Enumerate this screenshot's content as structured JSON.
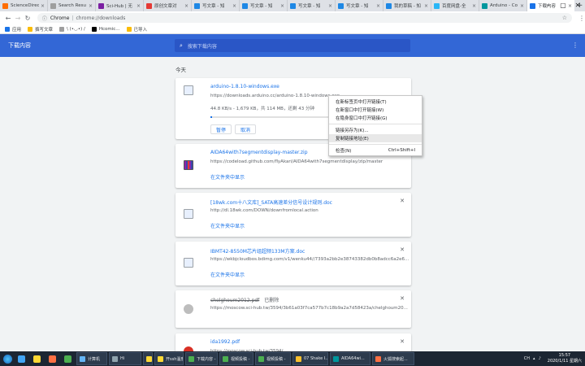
{
  "tabs": [
    {
      "label": "ScienceDirec",
      "color": "#ff6d00"
    },
    {
      "label": "Search Resu",
      "color": "#9e9e9e"
    },
    {
      "label": "Sci-Hub | 无",
      "color": "#7b1fa2"
    },
    {
      "label": "原创文章对",
      "color": "#e53935"
    },
    {
      "label": "写文章 - 知",
      "color": "#1e88e5"
    },
    {
      "label": "写文章 - 知",
      "color": "#1e88e5"
    },
    {
      "label": "写文章 - 知",
      "color": "#1e88e5"
    },
    {
      "label": "写文章 - 知",
      "color": "#1e88e5"
    },
    {
      "label": "我的草稿 - 知",
      "color": "#1e88e5"
    },
    {
      "label": "百度网盘-全",
      "color": "#29b6f6"
    },
    {
      "label": "Arduino - Co",
      "color": "#00979d"
    },
    {
      "label": "下载内容",
      "color": "#1a73e8",
      "active": true
    }
  ],
  "toolbar": {
    "scheme": "Chrome",
    "url": "chrome://downloads"
  },
  "bookmarks": [
    {
      "label": "应用",
      "color": "#1a73e8"
    },
    {
      "label": "撰写文章",
      "color": "#fbbc04"
    },
    {
      "label": "\\ (•◡•) /",
      "color": "#9e9e9e"
    },
    {
      "label": "Hcomic...",
      "color": "#000000"
    },
    {
      "label": "已导入",
      "color": "#fbbc04"
    }
  ],
  "downloads_page": {
    "title": "下载内容",
    "search_placeholder": "搜索下载内容",
    "date_label": "今天"
  },
  "downloads": [
    {
      "name": "arduino-1.8.10-windows.exe",
      "url": "https://downloads.arduino.cc/arduino-1.8.10-windows.exe",
      "status": "44.8 KB/s - 1,679 KB，共 114 MB，还剩 43 分钟",
      "progress": 0.015,
      "pause_label": "暂停",
      "cancel_label": "取消"
    },
    {
      "name": "AIDA64with7segmentdisplay-master.zip",
      "url": "https://codeload.github.com/flyAkari/AIDA64with7segmentdisplay/zip/master",
      "show_label": "在文件夹中显示"
    },
    {
      "name": "[18wk.com十八文库]_SATA高速差分信号设计规则.doc",
      "url": "http://dl.18wk.com/DOWN/downfromlocal.action",
      "show_label": "在文件夹中显示"
    },
    {
      "name": "IBMT42-8550M芯片组超频133M方案.doc",
      "url": "https://wkbjcloudbos.bdimg.com/v1/wenku44//7393a2bb2e38743382db0b8adcc6a2e6...",
      "show_label": "在文件夹中显示"
    },
    {
      "name": "chelghoum2012.pdf",
      "deleted_tag": "已删除",
      "url": "https://moscow.sci-hub.tw/3594/3b61a03f7ca577b7c18b9a2a7d58423a/chelghoum20..."
    },
    {
      "name": "ida1992.pdf",
      "url": "https://moscow.sci-hub.tw/3594/..."
    }
  ],
  "context_menu": [
    {
      "label": "在新标签页中打开链接(T)"
    },
    {
      "label": "在新窗口中打开链接(W)"
    },
    {
      "label": "在隐身窗口中打开链接(G)"
    },
    {
      "separator": true
    },
    {
      "label": "链接另存为(K)..."
    },
    {
      "label": "复制链接地址(E)",
      "highlighted": true
    },
    {
      "separator": true
    },
    {
      "label": "检查(N)",
      "shortcut": "Ctrl+Shift+I"
    }
  ],
  "taskbar": {
    "pinned": [
      {
        "name": "ie-icon",
        "color": "#42a5f5"
      },
      {
        "name": "explorer-icon",
        "color": "#fdd835"
      },
      {
        "name": "media-icon",
        "color": "#ff7043"
      },
      {
        "name": "chrome-icon",
        "color": "#4caf50"
      }
    ],
    "apps": [
      {
        "label": "计算机",
        "color": "#64b5f6"
      },
      {
        "label": "Hi",
        "color": "#90a4ae"
      },
      {
        "label": "",
        "color": "#fdd835"
      },
      {
        "label": "开ssh温度",
        "color": "#fdd835"
      },
      {
        "label": "下载内容 -",
        "color": "#4caf50"
      },
      {
        "label": "视频投稿 -",
        "color": "#4caf50"
      },
      {
        "label": "视频投稿 -",
        "color": "#4caf50"
      },
      {
        "label": "07 Shake I...",
        "color": "#fbc02d"
      },
      {
        "label": "AIDA64wi...",
        "color": "#00979d"
      },
      {
        "label": "火狐搜索起...",
        "color": "#ff7043"
      }
    ],
    "tray_text": "CH",
    "time": "15:57",
    "date": "2020/1/11 星期六"
  }
}
